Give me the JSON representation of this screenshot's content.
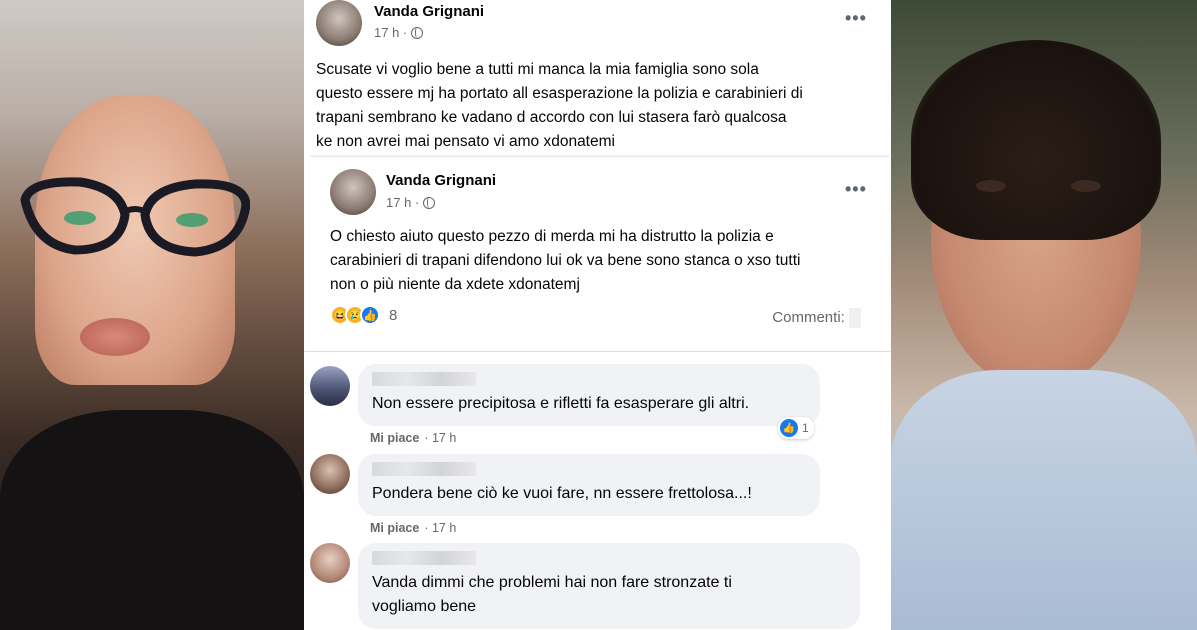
{
  "post": {
    "author": "Vanda Grignani",
    "time": "17 h ·",
    "text_lines": [
      "Scusate vi voglio bene a tutti mi manca la mia famiglia sono sola",
      "questo essere mj ha portato all esasperazione la polizia e carabinieri di",
      "trapani sembrano ke vadano d accordo con lui stasera farò qualcosa",
      "ke non avrei mai pensato vi amo xdonatemi"
    ],
    "more": "•••"
  },
  "shared_post": {
    "author": "Vanda Grignani",
    "time": "17 h ·",
    "text_lines": [
      "O chiesto aiuto questo pezzo di merda mi ha distrutto la polizia e",
      "carabinieri di trapani difendono lui ok va bene sono stanca o xso tutti",
      "non o più niente da xdete xdonatemj"
    ],
    "more": "•••",
    "reaction_count": "8",
    "comments_label": "Commenti:"
  },
  "comments": [
    {
      "text_lines": [
        "Non essere precipitosa e rifletti fa esasperare gli altri."
      ],
      "like_label": "Mi piace",
      "time": "· 17 h",
      "reaction_count": "1"
    },
    {
      "text_lines": [
        "Pondera bene ciò ke vuoi fare, nn essere frettolosa...!"
      ],
      "like_label": "Mi piace",
      "time": "· 17 h"
    },
    {
      "text_lines": [
        "Vanda dimmi che problemi hai non fare stronzate ti",
        "vogliamo bene"
      ]
    }
  ],
  "colors": {
    "facebook_blue": "#1877f2",
    "bubble_bg": "#f0f2f5",
    "meta_gray": "#65676b"
  },
  "icons": [
    "globe-icon",
    "more-options-icon",
    "haha-reaction-icon",
    "sad-reaction-icon",
    "like-reaction-icon"
  ]
}
